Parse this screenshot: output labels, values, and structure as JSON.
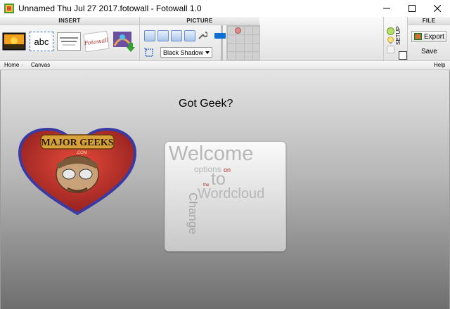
{
  "window": {
    "title": "Unnamed Thu Jul 27 2017.fotowall - Fotowall 1.0"
  },
  "ribbon": {
    "insert_header": "INSERT",
    "picture_header": "PICTURE",
    "file_header": "FILE",
    "insert_buttons": [
      {
        "name": "picture",
        "icon": "picture-icon"
      },
      {
        "name": "text",
        "label": "abc"
      },
      {
        "name": "wordcloud",
        "icon": "wordcloud-icon"
      },
      {
        "name": "fotowall-logo",
        "label": "Fotowall"
      },
      {
        "name": "web-download",
        "icon": "web-download-icon"
      }
    ],
    "shadow_select": "Black Shadow",
    "setup_label": "SETUP",
    "export_label": "Export",
    "save_label": "Save"
  },
  "breadcrumb": {
    "home": "Home",
    "canvas": "Canvas",
    "help": "Help"
  },
  "canvas": {
    "title": "Got Geek?",
    "heart_text": "MAJOR GEEKS",
    "heart_subtext": ".COM",
    "wordcloud": {
      "welcome": "Welcome",
      "options": "options",
      "on": "on",
      "the": "the",
      "to": "to",
      "wordcloud": "Wordcloud",
      "change": "Change"
    }
  }
}
